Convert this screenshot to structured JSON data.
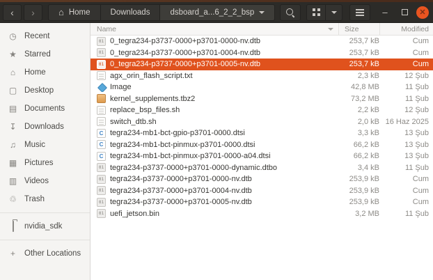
{
  "headerbar": {
    "back_label": "‹",
    "forward_label": "›",
    "breadcrumbs": [
      {
        "label": "Home",
        "icon": "home"
      },
      {
        "label": "Downloads"
      },
      {
        "label": "dsboard_a...6_2_2_bsp",
        "has_menu": true
      }
    ]
  },
  "icons": {
    "recent": "◷",
    "starred": "★",
    "home": "⌂",
    "desktop": "▢",
    "documents": "▤",
    "downloads": "↧",
    "music": "♫",
    "pictures": "▦",
    "videos": "▥",
    "trash": "♲",
    "plus": "+",
    "house": "⌂"
  },
  "sidebar": {
    "items": [
      {
        "label": "Recent",
        "icon": "recent"
      },
      {
        "label": "Starred",
        "icon": "starred"
      },
      {
        "label": "Home",
        "icon": "home"
      },
      {
        "label": "Desktop",
        "icon": "desktop"
      },
      {
        "label": "Documents",
        "icon": "documents"
      },
      {
        "label": "Downloads",
        "icon": "downloads"
      },
      {
        "label": "Music",
        "icon": "music"
      },
      {
        "label": "Pictures",
        "icon": "pictures"
      },
      {
        "label": "Videos",
        "icon": "videos"
      },
      {
        "label": "Trash",
        "icon": "trash"
      }
    ],
    "places": [
      {
        "label": "nvidia_sdk",
        "icon": "folder"
      }
    ],
    "other": {
      "label": "Other Locations",
      "icon": "plus"
    }
  },
  "list": {
    "columns": [
      "Name",
      "Size",
      "Modified"
    ],
    "sort_column": "Name",
    "files": [
      {
        "name": "0_tegra234-p3737-0000+p3701-0000-nv.dtb",
        "size": "253,7 kB",
        "modified": "Cum",
        "icon": "binary",
        "selected": false
      },
      {
        "name": "0_tegra234-p3737-0000+p3701-0004-nv.dtb",
        "size": "253,7 kB",
        "modified": "Cum",
        "icon": "binary",
        "selected": false
      },
      {
        "name": "0_tegra234-p3737-0000+p3701-0005-nv.dtb",
        "size": "253,7 kB",
        "modified": "Cum",
        "icon": "binary",
        "selected": true
      },
      {
        "name": "agx_orin_flash_script.txt",
        "size": "2,3 kB",
        "modified": "12 Şub",
        "icon": "text",
        "selected": false
      },
      {
        "name": "Image",
        "size": "42,8 MB",
        "modified": "11 Şub",
        "icon": "image",
        "selected": false
      },
      {
        "name": "kernel_supplements.tbz2",
        "size": "73,2 MB",
        "modified": "11 Şub",
        "icon": "archive",
        "selected": false
      },
      {
        "name": "replace_bsp_files.sh",
        "size": "2,2 kB",
        "modified": "12 Şub",
        "icon": "text",
        "selected": false
      },
      {
        "name": "switch_dtb.sh",
        "size": "2,0 kB",
        "modified": "16 Haz 2025",
        "icon": "text",
        "selected": false
      },
      {
        "name": "tegra234-mb1-bct-gpio-p3701-0000.dtsi",
        "size": "3,3 kB",
        "modified": "13 Şub",
        "icon": "c",
        "selected": false
      },
      {
        "name": "tegra234-mb1-bct-pinmux-p3701-0000.dtsi",
        "size": "66,2 kB",
        "modified": "13 Şub",
        "icon": "c",
        "selected": false
      },
      {
        "name": "tegra234-mb1-bct-pinmux-p3701-0000-a04.dtsi",
        "size": "66,2 kB",
        "modified": "13 Şub",
        "icon": "c",
        "selected": false
      },
      {
        "name": "tegra234-p3737-0000+p3701-0000-dynamic.dtbo",
        "size": "3,4 kB",
        "modified": "11 Şub",
        "icon": "binary",
        "selected": false
      },
      {
        "name": "tegra234-p3737-0000+p3701-0000-nv.dtb",
        "size": "253,9 kB",
        "modified": "Cum",
        "icon": "binary",
        "selected": false
      },
      {
        "name": "tegra234-p3737-0000+p3701-0004-nv.dtb",
        "size": "253,9 kB",
        "modified": "Cum",
        "icon": "binary",
        "selected": false
      },
      {
        "name": "tegra234-p3737-0000+p3701-0005-nv.dtb",
        "size": "253,9 kB",
        "modified": "Cum",
        "icon": "binary",
        "selected": false
      },
      {
        "name": "uefi_jetson.bin",
        "size": "3,2 MB",
        "modified": "11 Şub",
        "icon": "binary",
        "selected": false
      }
    ]
  },
  "colors": {
    "accent": "#e0521d",
    "close_button": "#e95420",
    "headerbar_bg": "#2c2b28",
    "sidebar_bg": "#f5f4f2"
  }
}
